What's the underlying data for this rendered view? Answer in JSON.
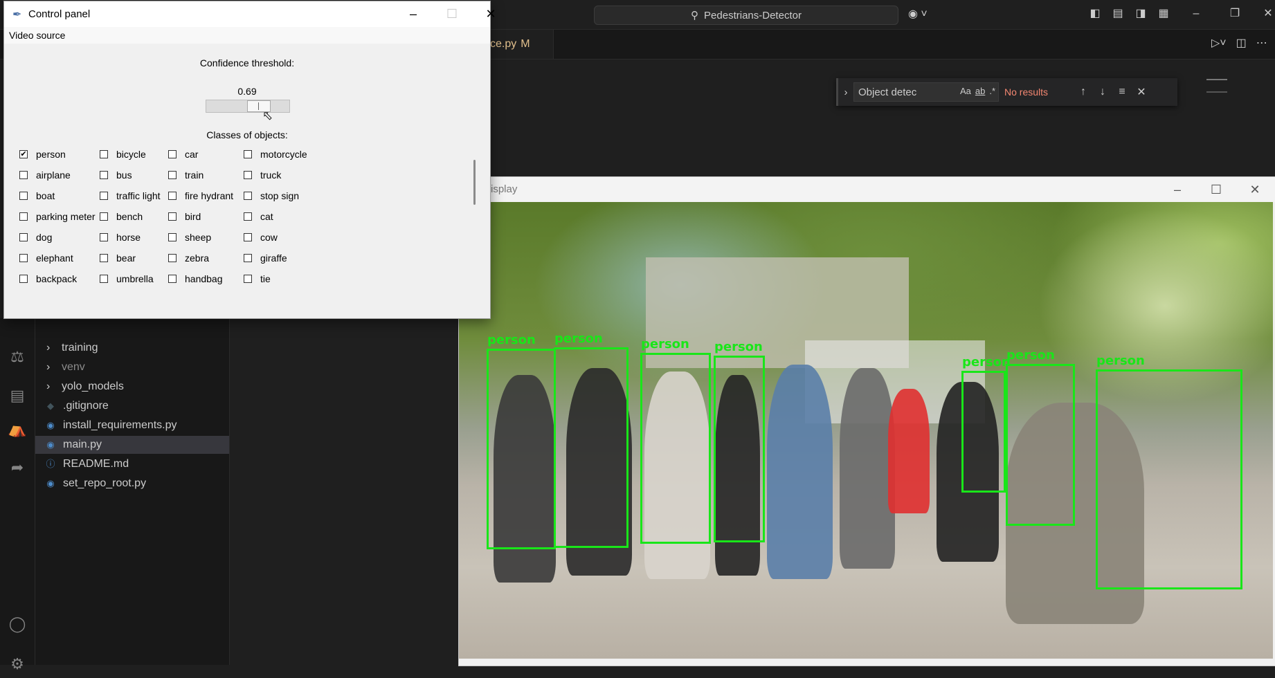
{
  "vscode": {
    "search_text": "Pedestrians-Detector",
    "tab_label": "ce.py",
    "tab_badge": "M",
    "find": {
      "query": "Object detec",
      "opt_case": "Aa",
      "opt_word": "ab",
      "opt_regex": ".*",
      "status": "No results"
    },
    "explorer": [
      {
        "label": "training",
        "kind": "folder"
      },
      {
        "label": "venv",
        "kind": "folder"
      },
      {
        "label": "yolo_models",
        "kind": "folder"
      },
      {
        "label": ".gitignore",
        "kind": "git"
      },
      {
        "label": "install_requirements.py",
        "kind": "python"
      },
      {
        "label": "main.py",
        "kind": "python",
        "selected": true
      },
      {
        "label": "README.md",
        "kind": "info"
      },
      {
        "label": "set_repo_root.py",
        "kind": "python"
      }
    ]
  },
  "display_window": {
    "title": "isplay",
    "detections": [
      {
        "label": "person"
      },
      {
        "label": "person"
      },
      {
        "label": "person"
      },
      {
        "label": "person"
      },
      {
        "label": "person"
      },
      {
        "label": "person"
      },
      {
        "label": "person"
      }
    ],
    "box_color": "#19e619"
  },
  "control_panel": {
    "title": "Control panel",
    "menu_video_source": "Video source",
    "confidence_label": "Confidence threshold:",
    "confidence_value": "0.69",
    "confidence_level": 0.69,
    "classes_label": "Classes of objects:",
    "classes": [
      {
        "label": "person",
        "checked": true
      },
      {
        "label": "bicycle",
        "checked": false
      },
      {
        "label": "car",
        "checked": false
      },
      {
        "label": "motorcycle",
        "checked": false
      },
      {
        "label": "airplane",
        "checked": false
      },
      {
        "label": "bus",
        "checked": false
      },
      {
        "label": "train",
        "checked": false
      },
      {
        "label": "truck",
        "checked": false
      },
      {
        "label": "boat",
        "checked": false
      },
      {
        "label": "traffic light",
        "checked": false
      },
      {
        "label": "fire hydrant",
        "checked": false
      },
      {
        "label": "stop sign",
        "checked": false
      },
      {
        "label": "parking meter",
        "checked": false
      },
      {
        "label": "bench",
        "checked": false
      },
      {
        "label": "bird",
        "checked": false
      },
      {
        "label": "cat",
        "checked": false
      },
      {
        "label": "dog",
        "checked": false
      },
      {
        "label": "horse",
        "checked": false
      },
      {
        "label": "sheep",
        "checked": false
      },
      {
        "label": "cow",
        "checked": false
      },
      {
        "label": "elephant",
        "checked": false
      },
      {
        "label": "bear",
        "checked": false
      },
      {
        "label": "zebra",
        "checked": false
      },
      {
        "label": "giraffe",
        "checked": false
      },
      {
        "label": "backpack",
        "checked": false
      },
      {
        "label": "umbrella",
        "checked": false
      },
      {
        "label": "handbag",
        "checked": false
      },
      {
        "label": "tie",
        "checked": false
      }
    ]
  }
}
